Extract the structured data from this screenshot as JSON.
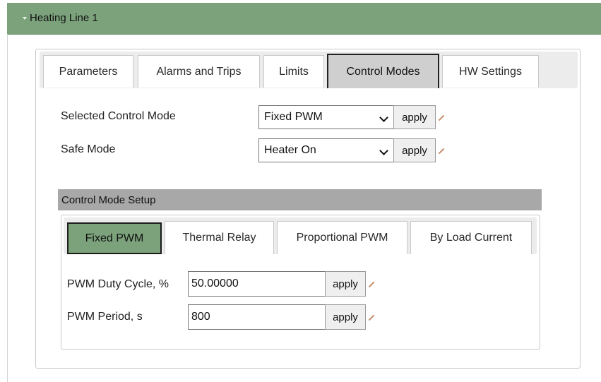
{
  "header": {
    "title": "Heating Line 1"
  },
  "tabs": [
    "Parameters",
    "Alarms and Trips",
    "Limits",
    "Control Modes",
    "HW Settings"
  ],
  "active_tab": "Control Modes",
  "settings": {
    "control_mode": {
      "label": "Selected Control Mode",
      "value": "Fixed PWM",
      "apply": "apply"
    },
    "safe_mode": {
      "label": "Safe Mode",
      "value": "Heater On",
      "apply": "apply"
    }
  },
  "setup": {
    "title": "Control Mode Setup",
    "subtabs": [
      "Fixed PWM",
      "Thermal Relay",
      "Proportional PWM",
      "By Load Current"
    ],
    "active_subtab": "Fixed PWM",
    "fields": [
      {
        "label": "PWM Duty Cycle, %",
        "value": "50.00000",
        "apply": "apply"
      },
      {
        "label": "PWM Period, s",
        "value": "800",
        "apply": "apply"
      }
    ]
  },
  "colors": {
    "header": "#7ba27b",
    "active_subtab": "#7ba27b",
    "section_bar": "#a8a8a8",
    "pencil": "#c68c6a"
  },
  "icons": {
    "header_toggle": "caret-down-icon",
    "edit": "pencil-icon",
    "dropdown": "chevron-down-icon"
  }
}
